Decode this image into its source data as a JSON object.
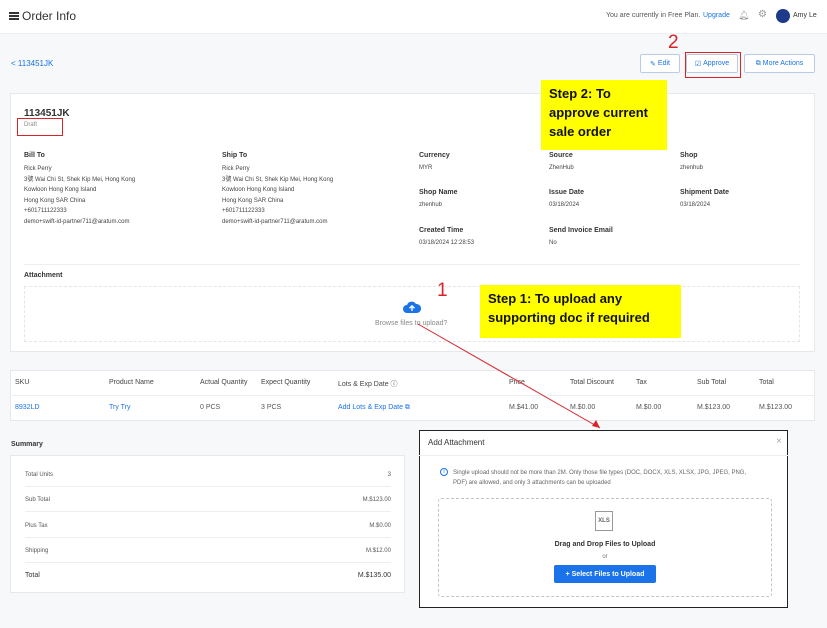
{
  "header": {
    "title": "Order Info",
    "plan_text": "You are currently in Free Plan.",
    "upgrade_label": "Upgrade",
    "user_name": "Amy Le"
  },
  "nav": {
    "back_label": "< 113451JK"
  },
  "actions": {
    "edit_label": "Edit",
    "approve_label": "Approve",
    "more_label": "More Actions"
  },
  "annotations": {
    "step2_number": "2",
    "step2_text": "Step 2: To approve current sale order",
    "step1_number": "1",
    "step1_text": "Step 1: To upload any supporting doc if required"
  },
  "order": {
    "number": "113451JK",
    "status": "Draft",
    "bill_to": {
      "label": "Bill To",
      "lines": [
        "Rick Perry",
        "3號 Wai Chi St, Shek Kip Mei, Hong Kong",
        "Kowloon Hong Kong Island",
        "Hong Kong SAR China",
        "+601711122333",
        "demo+swift-id-partner711@aratum.com"
      ]
    },
    "ship_to": {
      "label": "Ship To",
      "lines": [
        "Rick Perry",
        "3號 Wai Chi St, Shek Kip Mei, Hong Kong",
        "Kowloon Hong Kong Island",
        "Hong Kong SAR China",
        "+601711122333",
        "demo+swift-id-partner711@aratum.com"
      ]
    },
    "fields": [
      {
        "label": "Currency",
        "value": "MYR"
      },
      {
        "label": "Source",
        "value": "ZhenHub"
      },
      {
        "label": "Shop",
        "value": "zhenhub"
      },
      {
        "label": "Shop Name",
        "value": "zhenhub"
      },
      {
        "label": "Issue Date",
        "value": "03/18/2024"
      },
      {
        "label": "Shipment Date",
        "value": "03/18/2024"
      },
      {
        "label": "Created Time",
        "value": "03/18/2024 12:28:53"
      },
      {
        "label": "Send Invoice Email",
        "value": "No"
      }
    ],
    "attachment_label": "Attachment",
    "browse_text": "Browse files to upload?"
  },
  "items": {
    "headers": [
      "SKU",
      "Product Name",
      "Actual Quantity",
      "Expect Quantity",
      "Lots & Exp Date ⓘ",
      "Price",
      "Total Discount",
      "Tax",
      "Sub Total",
      "Total"
    ],
    "rows": [
      [
        "8932LD",
        "Try Try",
        "0 PCS",
        "3 PCS",
        "Add Lots & Exp Date ⧉",
        "M.$41.00",
        "M.$0.00",
        "M.$0.00",
        "M.$123.00",
        "M.$123.00"
      ]
    ]
  },
  "summary": {
    "title": "Summary",
    "rows": [
      {
        "label": "Total Units",
        "value": "3"
      },
      {
        "label": "Sub Total",
        "value": "M.$123.00"
      },
      {
        "label": "Plus Tax",
        "value": "M.$0.00"
      },
      {
        "label": "Shipping",
        "value": "M.$12.00"
      },
      {
        "label": "Total",
        "value": "M.$135.00"
      }
    ]
  },
  "modal": {
    "title": "Add Attachment",
    "close": "×",
    "info": "Single upload should not be more than 2M. Only those file types (DOC, DOCX, XLS, XLSX, JPG, JPEG, PNG, PDF) are allowed, and only 3 attachments can be uploaded",
    "file_icon_text": "XLS",
    "drag_text": "Drag and Drop Files to Upload",
    "or_text": "or",
    "select_label": "+ Select Files to Upload"
  },
  "colors": {
    "accent": "#1a73e8",
    "highlight": "#ffff00",
    "annotation_red": "#d8232a"
  }
}
